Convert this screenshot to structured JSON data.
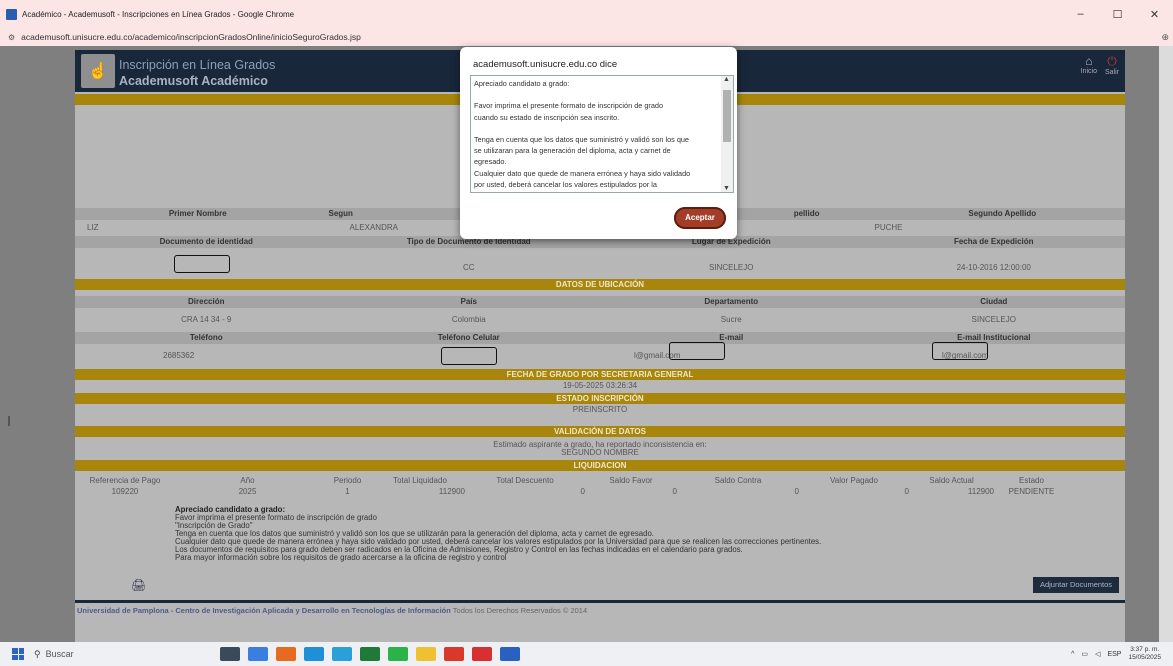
{
  "browser": {
    "title": "Académico - Academusoft - Inscripciones en Línea Grados - Google Chrome",
    "url": "academusoft.unisucre.edu.co/academico/inscripcionGradosOnline/inicioSeguroGrados.jsp",
    "controls": {
      "minimize": "–",
      "maximize": "☐",
      "close": "✕"
    },
    "zoom_icon": "zoom-icon"
  },
  "header": {
    "line1": "Inscripción en Línea Grados",
    "line2": "Academusoft Académico",
    "inicio": "Inicio",
    "salir": "Salir"
  },
  "personal": {
    "headers": [
      "Primer Nombre",
      "Segundo Nombre",
      "Primer Apellido",
      "Segundo Apellido"
    ],
    "values": [
      "LIZ",
      "ALEXANDRA",
      "",
      "PUCHE"
    ],
    "header_visible": [
      "Primer Nombre",
      "Segun",
      "pellido",
      "Segundo Apellido"
    ]
  },
  "identity": {
    "headers": [
      "Documento de identidad",
      "Tipo de Documento de Identidad",
      "Lugar de Expedición",
      "Fecha de Expedición"
    ],
    "values": [
      "",
      "CC",
      "SINCELEJO",
      "24-10-2016 12:00:00"
    ]
  },
  "location": {
    "section": "DATOS DE UBICACIÓN",
    "headers1": [
      "Dirección",
      "País",
      "Departamento",
      "Ciudad"
    ],
    "values1": [
      "CRA 14 34 - 9",
      "Colombia",
      "Sucre",
      "SINCELEJO"
    ],
    "headers2": [
      "Teléfono",
      "Teléfono Celular",
      "E-mail",
      "E-mail Institucional"
    ],
    "values2": [
      "2685362",
      "",
      "l@gmail.com",
      "l@gmail.com"
    ]
  },
  "grade_date": {
    "section": "FECHA DE GRADO POR SECRETARIA GENERAL",
    "value": "19-05-2025 03:26:34"
  },
  "status": {
    "section": "ESTADO INSCRIPCIÓN",
    "value": "PREINSCRITO"
  },
  "validation": {
    "section": "VALIDACIÓN DE DATOS",
    "line1": "Estimado aspirante a grado, ha reportado inconsistencia en:",
    "line2": "SEGUNDO NOMBRE"
  },
  "liquidation": {
    "section": "LIQUIDACION",
    "headers": [
      "Referencia de Pago",
      "Año",
      "Periodo",
      "Total Liquidado",
      "Total Descuento",
      "Saldo Favor",
      "Saldo Contra",
      "Valor Pagado",
      "Saldo Actual",
      "Estado"
    ],
    "row": [
      "109220",
      "2025",
      "1",
      "112900",
      "0",
      "0",
      "0",
      "0",
      "112900",
      "PENDIENTE"
    ]
  },
  "note": {
    "title": "Apreciado candidato a grado:",
    "lines": [
      "Favor imprima el presente formato de inscripción de grado",
      "\"Inscripción de Grado\"",
      "Tenga en cuenta que los datos que suministró y validó son los que se utilizarán para la generación del diploma, acta y carnet de egresado.",
      "Cualquier dato que quede de manera errónea y haya sido validado por usted, deberá cancelar los valores estipulados por la Universidad para que se realicen las correcciones pertinentes.",
      "Los documentos de requisitos para grado deben ser radicados en la Oficina de Admisiones, Registro y Control en las fechas indicadas en el calendario para grados.",
      "Para mayor información sobre los requisitos de grado acercarse a la oficina de registro y control"
    ]
  },
  "attach_button": "Adjuntar Documentos",
  "footer": {
    "org": "Universidad de Pamplona - Centro de Investigación Aplicada y Desarrollo en Tecnologías de Información",
    "rights": "Todos los Derechos Reservados © 2014"
  },
  "dialog": {
    "title": "academusoft.unisucre.edu.co dice",
    "lines": [
      "Apreciado candidato a grado:",
      "",
      "  Favor imprima el presente formato de inscripción de grado",
      "cuando su estado de inscripción sea inscrito.",
      "",
      "Tenga en cuenta que los datos que suministró y validó son los que",
      "se utilizaran para la generación del diploma, acta y carnet de",
      "egresado.",
      " Cualquier dato que quede de manera errónea y haya sido validado",
      "por usted, deberá cancelar los valores estipulados por la"
    ],
    "button": "Aceptar"
  },
  "taskbar": {
    "search": "Buscar",
    "lang": "ESP",
    "time": "3:37 p. m.",
    "date": "15/05/2025",
    "app_colors": [
      "#3a4a5a",
      "#3b7de0",
      "#e66a1f",
      "#1f8fd8",
      "#2aa0d8",
      "#1f7a3a",
      "#2bb34a",
      "#f0c030",
      "#d8392b",
      "#d83030",
      "#2a60c0"
    ]
  }
}
